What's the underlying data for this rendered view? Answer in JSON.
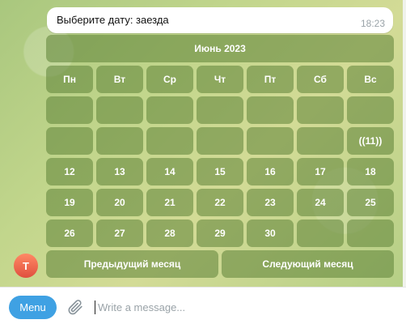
{
  "message": {
    "text": "Выберите дату: заезда",
    "time": "18:23"
  },
  "keyboard": {
    "month_title": "Июнь 2023",
    "weekdays": [
      "Пн",
      "Вт",
      "Ср",
      "Чт",
      "Пт",
      "Сб",
      "Вс"
    ],
    "weeks": [
      [
        "",
        "",
        "",
        "",
        "",
        "",
        ""
      ],
      [
        "",
        "",
        "",
        "",
        "",
        "",
        "((11))"
      ],
      [
        "12",
        "13",
        "14",
        "15",
        "16",
        "17",
        "18"
      ],
      [
        "19",
        "20",
        "21",
        "22",
        "23",
        "24",
        "25"
      ],
      [
        "26",
        "27",
        "28",
        "29",
        "30",
        "",
        ""
      ]
    ],
    "prev_month_label": "Предыдущий месяц",
    "next_month_label": "Следующий месяц"
  },
  "avatar": {
    "letter": "T"
  },
  "composer": {
    "menu_label": "Menu",
    "placeholder": "Write a message..."
  },
  "colors": {
    "keyboard_button": "#5c8236",
    "menu_button": "#3fa1e3",
    "avatar": "#e04f3f"
  }
}
